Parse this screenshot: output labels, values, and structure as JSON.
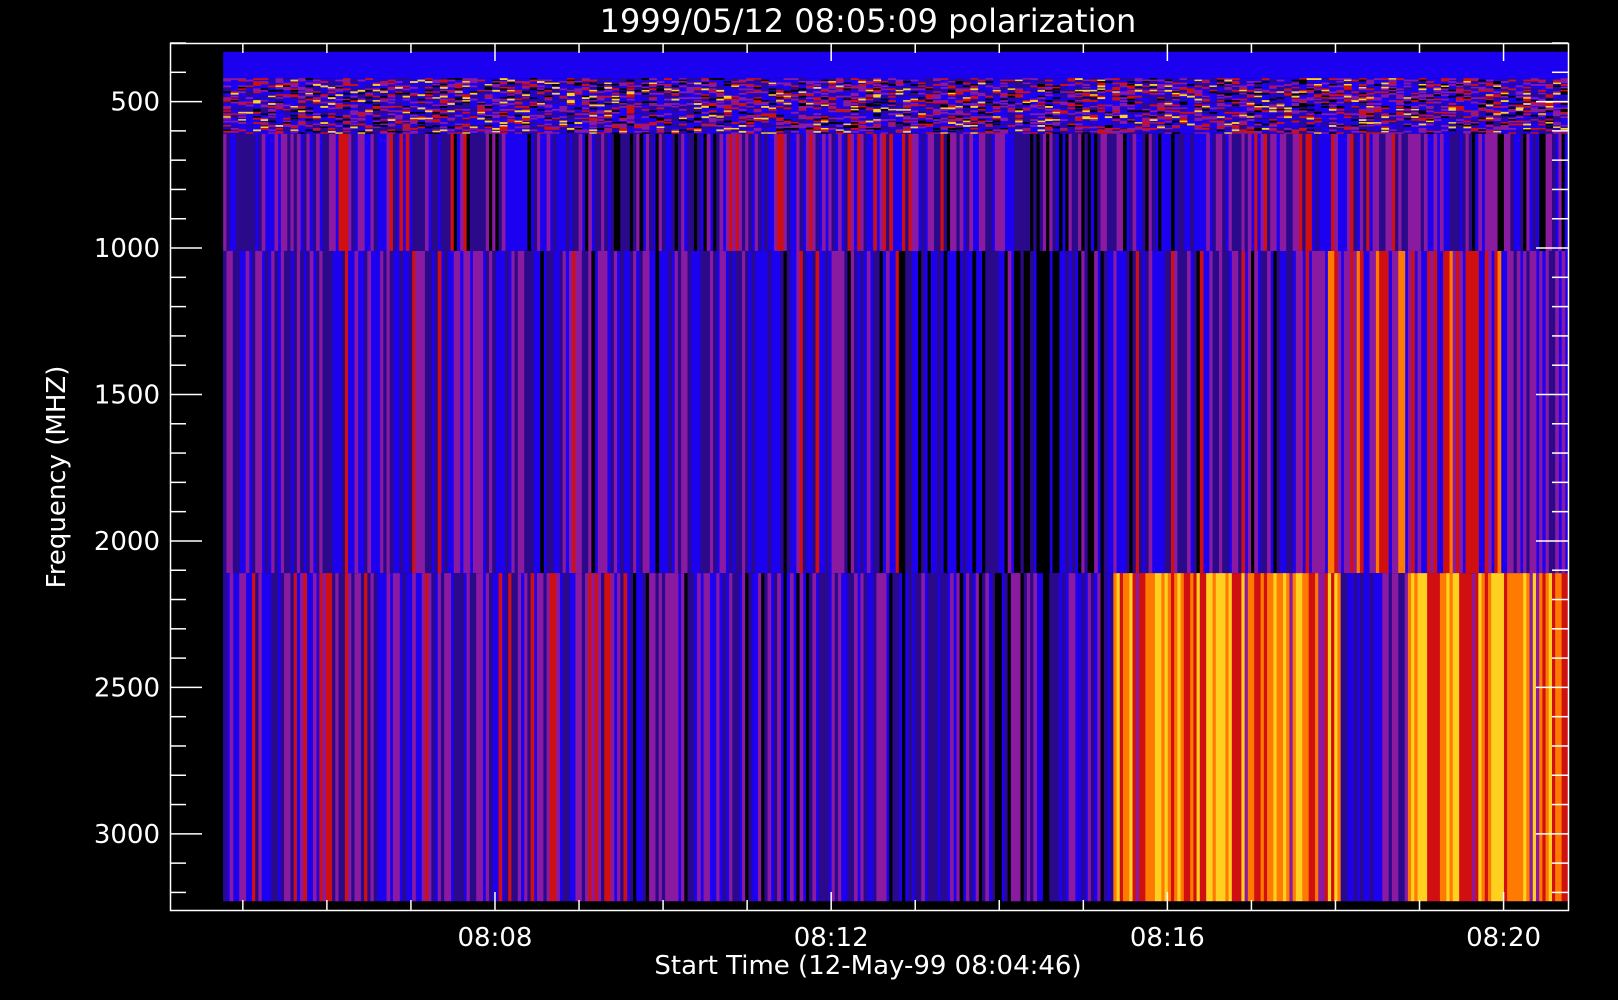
{
  "chart_data": {
    "type": "heatmap",
    "title": "1999/05/12 08:05:09 polarization",
    "xlabel": "Start Time (12-May-99 08:04:46)",
    "ylabel": "Frequency (MHZ)",
    "x_start": "08:04:46",
    "x_end": "08:20:46",
    "x_axis_range": [
      "08:04:08",
      "08:20:46"
    ],
    "x_ticks": [
      "08:08",
      "08:12",
      "08:16",
      "08:20"
    ],
    "y_axis_range": [
      300,
      3260
    ],
    "y_inverted": true,
    "y_ticks": [
      500,
      1000,
      1500,
      2000,
      2500,
      3000
    ],
    "frequency_bands_mhz": [
      {
        "from": 330,
        "to": 420,
        "appearance": "uniform blue"
      },
      {
        "from": 420,
        "to": 610,
        "appearance": "fine-structured, mixed blue, red and yellow"
      },
      {
        "from": 610,
        "to": 1010,
        "appearance": "vertical streaks, blue with scattered red"
      },
      {
        "from": 1010,
        "to": 2110,
        "appearance": "vertical streaks, blue with dark and red stretches"
      },
      {
        "from": 2110,
        "to": 3230,
        "appearance": "vertical streaks, blue with strong red and orange stretches"
      }
    ],
    "colormap": [
      "#000000",
      "#2a0a8a",
      "#1c00f0",
      "#8a1aa0",
      "#d01010",
      "#ff7a00",
      "#ffd020"
    ],
    "grid": false,
    "legend": "none"
  }
}
